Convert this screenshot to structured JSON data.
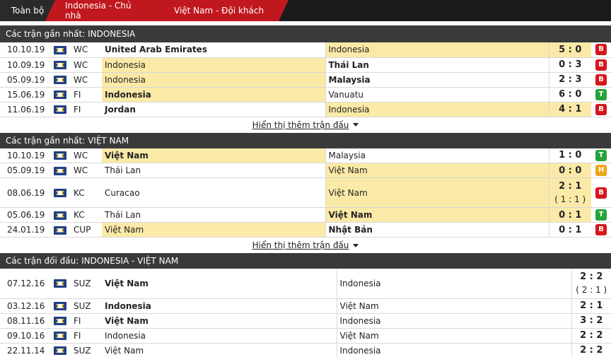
{
  "tabs": [
    "Toàn bộ",
    "Indonesia - Chủ nhà",
    "Việt Nam - Đội khách"
  ],
  "colors": {
    "lose": "#d6161c",
    "win": "#27a33b",
    "draw": "#f0a418",
    "highlight": "#fbeaa7",
    "tab_active": "#c0181e"
  },
  "sections": [
    {
      "title": "Các trận gần nhất: INDONESIA",
      "more": "Hiển thị thêm trận đấu",
      "rows": [
        {
          "date": "10.10.19",
          "comp": "WC",
          "home": "United Arab Emirates",
          "away": "Indonesia",
          "score": "5 : 0",
          "sub": "",
          "result": "B"
        },
        {
          "date": "10.09.19",
          "comp": "WC",
          "home": "Indonesia",
          "away": "Thái Lan",
          "score": "0 : 3",
          "sub": "",
          "result": "B"
        },
        {
          "date": "05.09.19",
          "comp": "WC",
          "home": "Indonesia",
          "away": "Malaysia",
          "score": "2 : 3",
          "sub": "",
          "result": "B"
        },
        {
          "date": "15.06.19",
          "comp": "FI",
          "home": "Indonesia",
          "away": "Vanuatu",
          "score": "6 : 0",
          "sub": "",
          "result": "T"
        },
        {
          "date": "11.06.19",
          "comp": "FI",
          "home": "Jordan",
          "away": "Indonesia",
          "score": "4 : 1",
          "sub": "",
          "result": "B"
        }
      ]
    },
    {
      "title": "Các trận gần nhất: VIỆT NAM",
      "more": "Hiển thị thêm trận đấu",
      "rows": [
        {
          "date": "10.10.19",
          "comp": "WC",
          "home": "Việt Nam",
          "away": "Malaysia",
          "score": "1 : 0",
          "sub": "",
          "result": "T"
        },
        {
          "date": "05.09.19",
          "comp": "WC",
          "home": "Thái Lan",
          "away": "Việt Nam",
          "score": "0 : 0",
          "sub": "",
          "result": "H"
        },
        {
          "date": "08.06.19",
          "comp": "KC",
          "home": "Curacao",
          "away": "Việt Nam",
          "score": "2 : 1",
          "sub": "( 1 : 1 )",
          "result": "B"
        },
        {
          "date": "05.06.19",
          "comp": "KC",
          "home": "Thái Lan",
          "away": "Việt Nam",
          "score": "0 : 1",
          "sub": "",
          "result": "T"
        },
        {
          "date": "24.01.19",
          "comp": "CUP",
          "home": "Việt Nam",
          "away": "Nhật Bản",
          "score": "0 : 1",
          "sub": "",
          "result": "B"
        }
      ]
    },
    {
      "title": "Các trận đối đầu: INDONESIA - VIỆT NAM",
      "rows": [
        {
          "date": "07.12.16",
          "comp": "SUZ",
          "home": "Việt Nam",
          "away": "Indonesia",
          "score": "2 : 2",
          "sub": "( 2 : 1 )"
        },
        {
          "date": "03.12.16",
          "comp": "SUZ",
          "home": "Indonesia",
          "away": "Việt Nam",
          "score": "2 : 1",
          "sub": ""
        },
        {
          "date": "08.11.16",
          "comp": "FI",
          "home": "Việt Nam",
          "away": "Indonesia",
          "score": "3 : 2",
          "sub": ""
        },
        {
          "date": "09.10.16",
          "comp": "FI",
          "home": "Indonesia",
          "away": "Việt Nam",
          "score": "2 : 2",
          "sub": ""
        },
        {
          "date": "22.11.14",
          "comp": "SUZ",
          "home": "Việt Nam",
          "away": "Indonesia",
          "score": "2 : 2",
          "sub": ""
        }
      ]
    }
  ]
}
